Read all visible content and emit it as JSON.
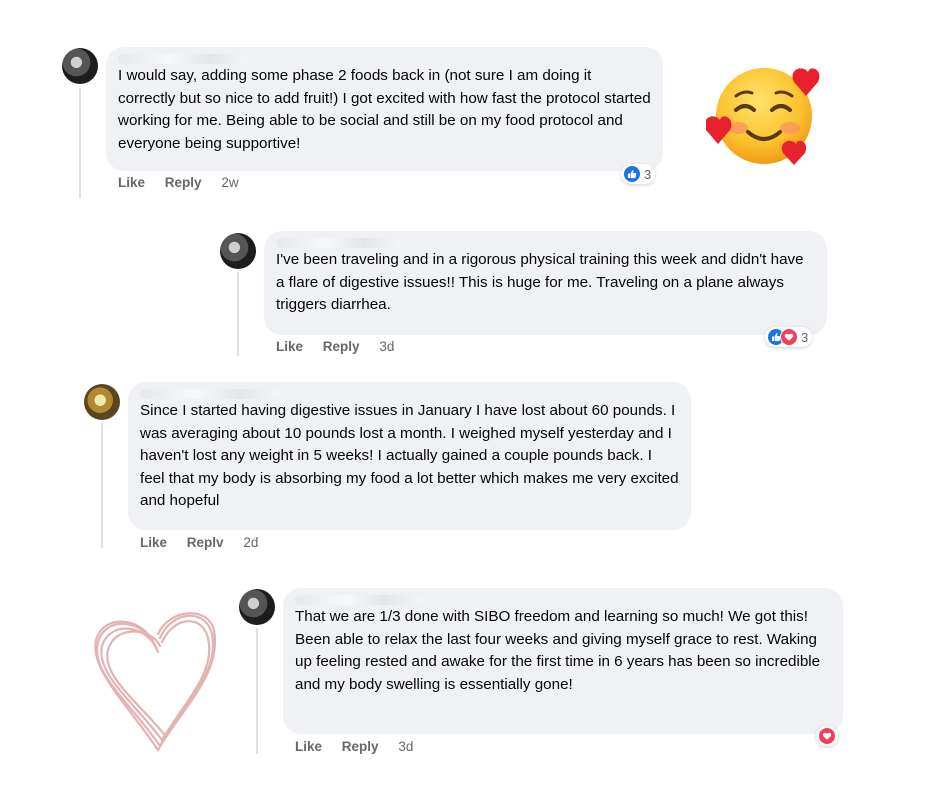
{
  "comments": [
    {
      "text": "I would say, adding some phase 2 foods back in (not sure I am doing it correctly but so nice to add fruit!) I got excited with how fast the protocol started working for me. Being able to be social and still be on my food protocol and everyone being supportive!",
      "actions": {
        "like": "Like",
        "reply": "Reply",
        "time": "2w"
      },
      "reactions": {
        "types": [
          "like"
        ],
        "count": "3"
      }
    },
    {
      "text": "I've been traveling and in a rigorous physical training this week and didn't have a flare of digestive issues!! This is huge for me. Traveling on a plane always triggers diarrhea.",
      "actions": {
        "like": "Like",
        "reply": "Reply",
        "time": "3d"
      },
      "reactions": {
        "types": [
          "like",
          "love"
        ],
        "count": "3"
      }
    },
    {
      "text": "Since I started having digestive issues in January I have lost about 60 pounds. I was averaging about 10 pounds lost a month. I weighed myself yesterday and I haven't lost any weight in 5 weeks! I actually gained a couple pounds back. I feel that my body is absorbing my food a lot better which makes me very excited and hopeful",
      "actions": {
        "like": "Like",
        "reply": "Replv",
        "time": "2d"
      },
      "reactions": null
    },
    {
      "text": "That we are 1/3 done with SIBO freedom and learning so much! We got this! Been able to relax the last four weeks and giving myself grace to rest. Waking up feeling rested and awake for the first time in 6 years has been so incredible and my body swelling is essentially gone!",
      "actions": {
        "like": "Like",
        "reply": "Reply",
        "time": "3d"
      },
      "reactions": {
        "types": [
          "love"
        ],
        "count": ""
      }
    }
  ],
  "colors": {
    "bubble": "#eff1f4",
    "action_text": "#65676b",
    "like_blue": "#1b74e4",
    "love_red": "#f33e58",
    "sketch_heart": "#e3b3b3"
  },
  "decorations": [
    "smiling-face-with-hearts-emoji",
    "hand-drawn-heart-doodle"
  ]
}
